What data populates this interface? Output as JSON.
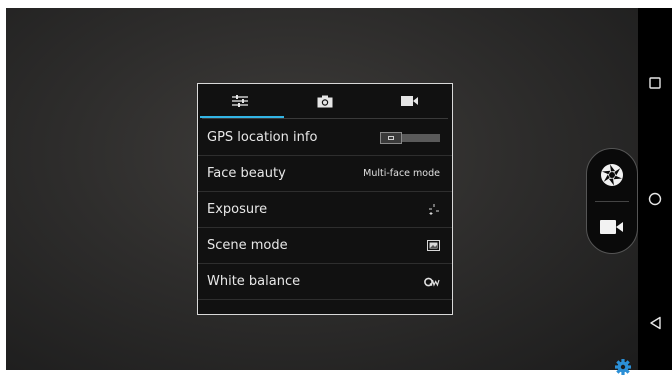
{
  "camera_settings": {
    "tabs": [
      {
        "icon": "settings-sliders-icon"
      },
      {
        "icon": "camera-icon"
      },
      {
        "icon": "video-camera-icon"
      }
    ],
    "selected_tab": 0,
    "rows": [
      {
        "label": "GPS location info",
        "control": "toggle",
        "state": "off"
      },
      {
        "label": "Face beauty",
        "value": "Multi-face mode"
      },
      {
        "label": "Exposure",
        "icon": "exposure-icon"
      },
      {
        "label": "Scene mode",
        "icon": "scene-mode-icon"
      },
      {
        "label": "White balance",
        "icon": "white-balance-auto-icon"
      }
    ]
  },
  "shutter": {
    "photo_icon": "aperture-icon",
    "video_icon": "video-camera-icon"
  },
  "nav_bar": {
    "icons": [
      "recent-apps-icon",
      "home-icon",
      "back-icon"
    ]
  },
  "colors": {
    "accent": "#33b5e5",
    "panel_bg": "#111111",
    "gear": "#2b8fd6"
  }
}
